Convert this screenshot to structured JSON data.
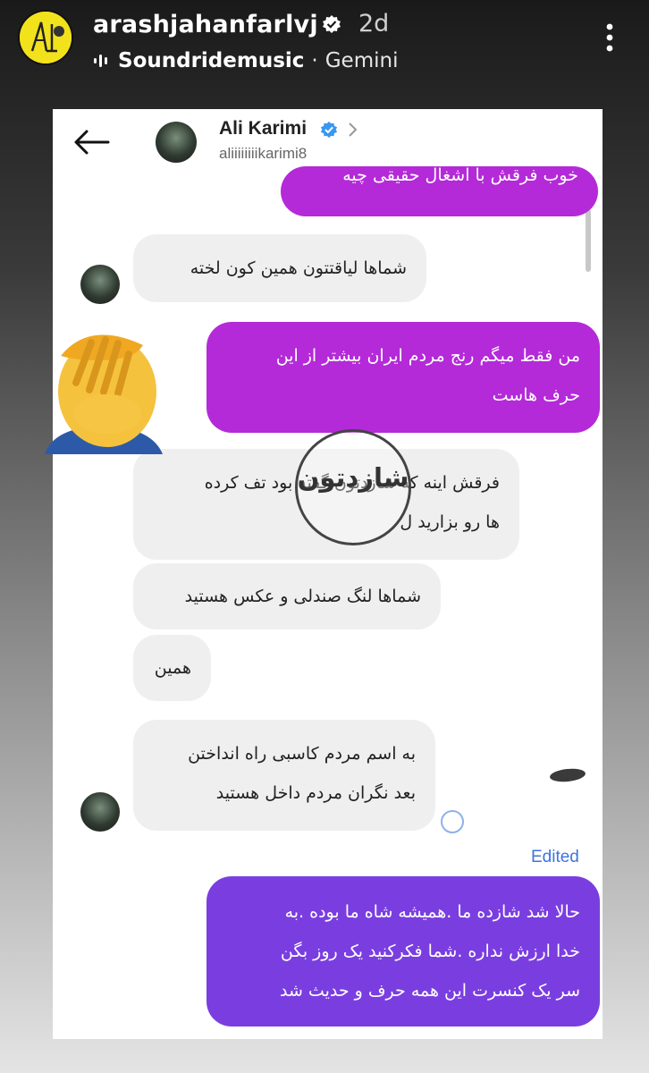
{
  "story": {
    "username": "arashjahanfarlvj",
    "time": "2d",
    "music_track": "Soundridemusic",
    "music_separator": "·",
    "music_artist": "Gemini"
  },
  "dm": {
    "name": "Ali Karimi",
    "handle": "aliiiiiiiikarimi8",
    "edited_label": "Edited",
    "zoom_label": "شازدتون",
    "messages": [
      {
        "side": "out",
        "text": "خوب فرقش با اشغال حقیقی چیه"
      },
      {
        "side": "in",
        "text": "شماها لیاقتتون همین کون لخته"
      },
      {
        "side": "out",
        "line1": "من فقط میگم رنج مردم ایران بیشتر از این",
        "line2": "حرف هاست"
      },
      {
        "side": "in",
        "line1": "فرقش اینه که شازدتون گفته بود تف کرده",
        "line2": "ها رو بزارید ل"
      },
      {
        "side": "in",
        "text": "شماها لنگ صندلی و عکس هستید"
      },
      {
        "side": "in",
        "text": "همین"
      },
      {
        "side": "in",
        "line1": "به اسم مردم کاسبی راه انداختن",
        "line2": "بعد نگران  مردم داخل هستید"
      },
      {
        "side": "out",
        "line1": "حالا شد شازده ما .همیشه شاه ما بوده .به",
        "line2": "خدا ارزش نداره .شما فکرکنید یک روز بگن",
        "line3": "سر یک کنسرت این همه حرف و حدیث شد"
      }
    ]
  },
  "colors": {
    "outgoing": "#b42ad8",
    "outgoing_alt": "#7a3ee0",
    "incoming": "#efefef",
    "verified": "#3897f0",
    "edited": "#3d73e0"
  },
  "icons": [
    "more-vert-icon",
    "music-bars-icon",
    "verified-icon",
    "back-arrow-icon",
    "chevron-right-icon",
    "facepalm-emoji"
  ]
}
